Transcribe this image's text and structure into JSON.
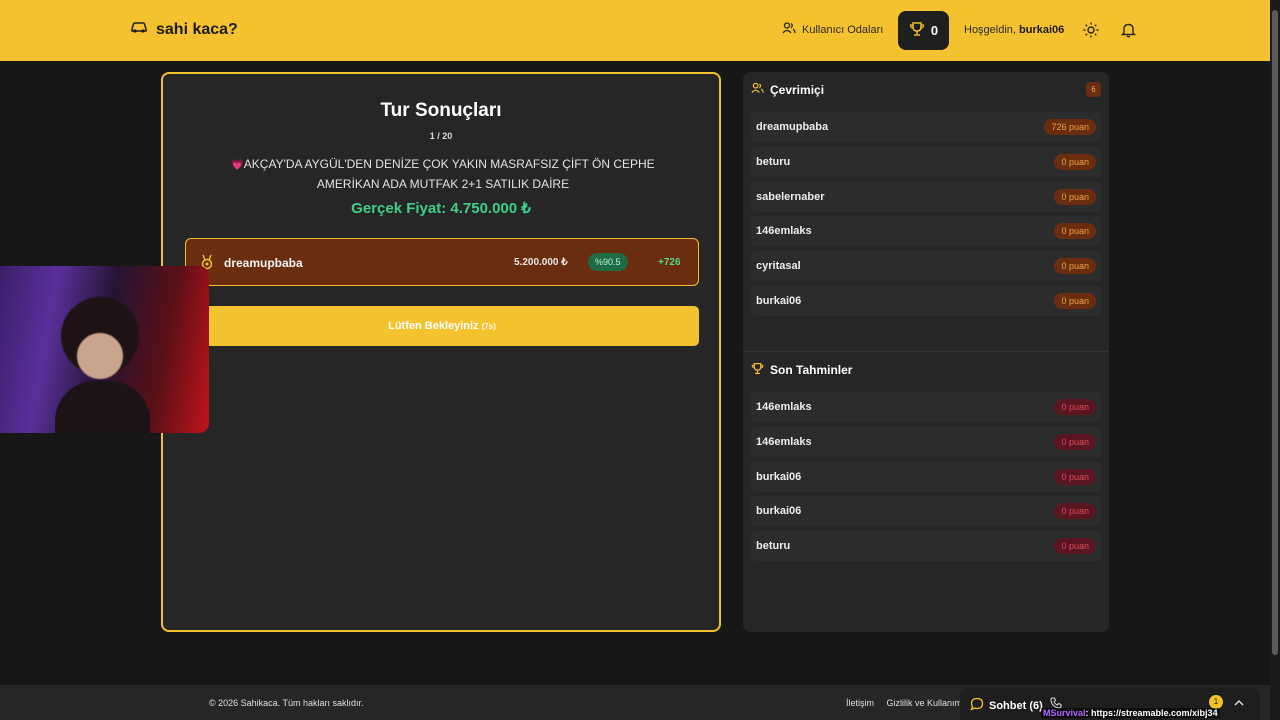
{
  "header": {
    "brand": "sahi kaca?",
    "rooms_label": "Kullanıcı Odaları",
    "trophy_count": "0",
    "welcome_prefix": "Hoşgeldin,",
    "username": "burkai06"
  },
  "results": {
    "title": "Tur Sonuçları",
    "round": "1 / 20",
    "listing_title": "AKÇAY'DA AYGÜL'DEN DENİZE ÇOK YAKIN MASRAFSIZ ÇİFT ÖN CEPHE AMERİKAN ADA MUTFAK 2+1 SATILIK DAİRE",
    "real_price": "Gerçek Fiyat: 4.750.000 ₺",
    "winner": {
      "name": "dreamupbaba",
      "guess": "5.200.000 ₺",
      "accuracy": "%90.5",
      "points": "+726"
    },
    "wait_label": "Lütfen Bekleyiniz",
    "wait_timer": "(7s)"
  },
  "online": {
    "title": "Çevrimiçi",
    "count": "6",
    "users": [
      {
        "name": "dreamupbaba",
        "score": "726 puan"
      },
      {
        "name": "beturu",
        "score": "0 puan"
      },
      {
        "name": "sabelernaber",
        "score": "0 puan"
      },
      {
        "name": "146emlaks",
        "score": "0 puan"
      },
      {
        "name": "cyritasal",
        "score": "0 puan"
      },
      {
        "name": "burkai06",
        "score": "0 puan"
      }
    ]
  },
  "recent": {
    "title": "Son Tahminler",
    "items": [
      {
        "name": "146emlaks",
        "score": "0 puan"
      },
      {
        "name": "146emlaks",
        "score": "0 puan"
      },
      {
        "name": "burkai06",
        "score": "0 puan"
      },
      {
        "name": "burkai06",
        "score": "0 puan"
      },
      {
        "name": "beturu",
        "score": "0 puan"
      }
    ]
  },
  "footer": {
    "copyright": "© 2026 Sahikaca. Tüm hakları saklıdır.",
    "contact": "İletişim",
    "privacy": "Gizlilik ve Kullanım"
  },
  "chat": {
    "label": "Sohbet (6)",
    "notif_count": "1"
  },
  "watermark": {
    "user": "MSurvival",
    "text": ": https://streamable.com/xibj34"
  },
  "colors": {
    "accent": "#f4c22e",
    "success": "#3fcf86",
    "panel": "#262626"
  }
}
